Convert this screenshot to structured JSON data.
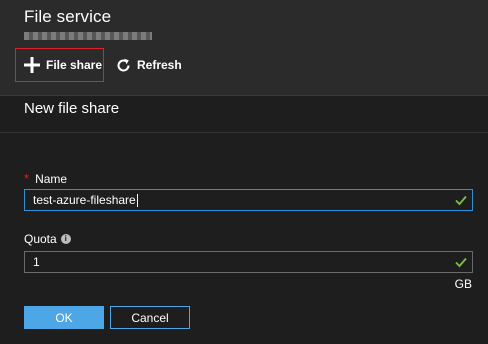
{
  "header": {
    "title": "File service"
  },
  "toolbar": {
    "file_share_label": "File share",
    "refresh_label": "Refresh"
  },
  "panel": {
    "title": "New file share",
    "name": {
      "required_mark": "*",
      "label": "Name",
      "value": "test-azure-fileshare"
    },
    "quota": {
      "label": "Quota",
      "value": "1",
      "unit": "GB"
    },
    "buttons": {
      "ok_label": "OK",
      "cancel_label": "Cancel"
    }
  },
  "colors": {
    "accent_blue": "#4da6e6",
    "focus_blue": "#2f8fd8",
    "highlight_red": "#e0202a",
    "valid_green": "#7ac142"
  },
  "icons": [
    "plus-icon",
    "refresh-icon",
    "info-icon",
    "checkmark-icon"
  ]
}
